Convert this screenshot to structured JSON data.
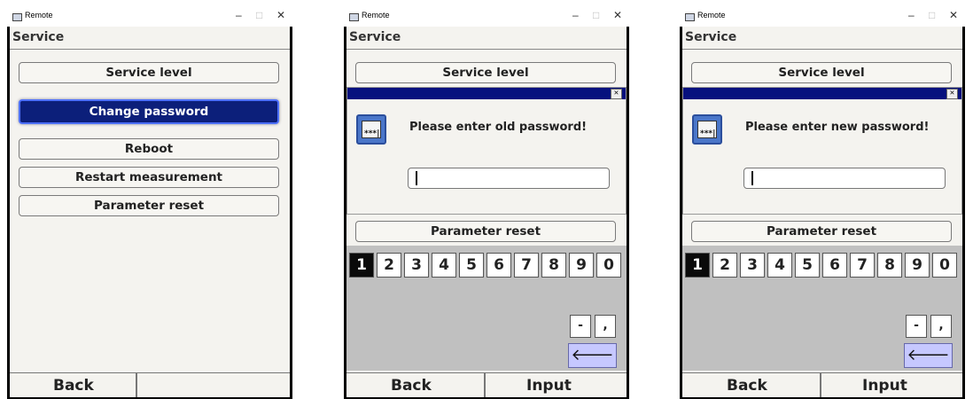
{
  "windows": [
    {
      "title": "Remote",
      "header": "Service",
      "buttons": [
        "Service level",
        "Change password",
        "Reboot",
        "Restart measurement",
        "Parameter reset"
      ],
      "softkeys": [
        "Back",
        ""
      ]
    },
    {
      "title": "Remote",
      "header": "Service",
      "buttons": [
        "Service level",
        "Parameter reset"
      ],
      "dialog": {
        "message": "Please enter old password!",
        "icon_text": "***|",
        "input_value": ""
      },
      "keys": [
        "1",
        "2",
        "3",
        "4",
        "5",
        "6",
        "7",
        "8",
        "9",
        "0"
      ],
      "special_keys": [
        "-",
        ","
      ],
      "backspace": "🡐",
      "softkeys": [
        "Back",
        "Input"
      ]
    },
    {
      "title": "Remote",
      "header": "Service",
      "buttons": [
        "Service level",
        "Parameter reset"
      ],
      "dialog": {
        "message": "Please enter new password!",
        "icon_text": "***|",
        "input_value": ""
      },
      "keys": [
        "1",
        "2",
        "3",
        "4",
        "5",
        "6",
        "7",
        "8",
        "9",
        "0"
      ],
      "special_keys": [
        "-",
        ","
      ],
      "backspace": "🡐",
      "softkeys": [
        "Back",
        "Input"
      ]
    }
  ],
  "window_controls": {
    "minimize": "–",
    "maximize": "□",
    "close": "✕"
  }
}
